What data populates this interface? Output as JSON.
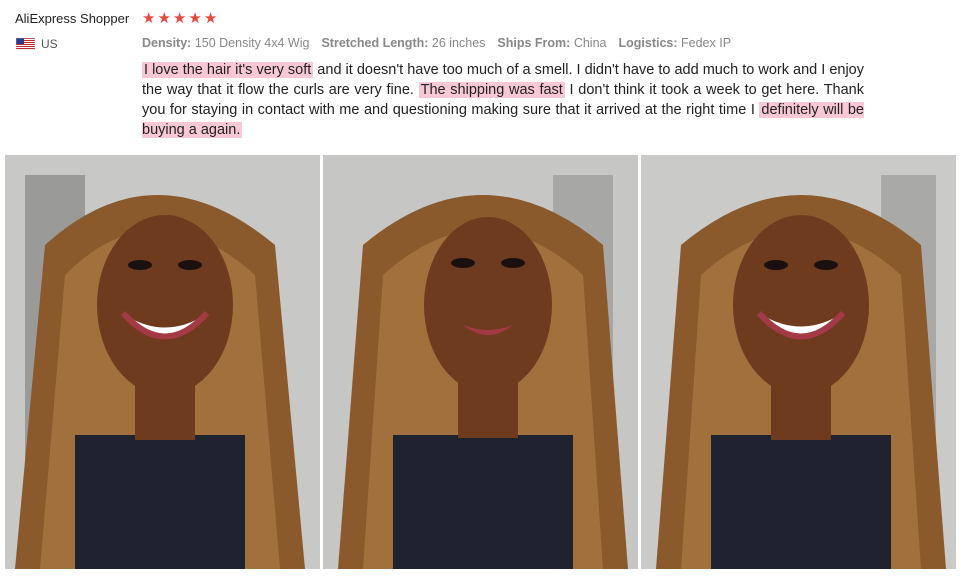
{
  "review": {
    "reviewer_name": "AliExpress Shopper",
    "rating": 5,
    "country": "US",
    "specs": [
      {
        "label": "Density:",
        "value": "150 Density 4x4 Wig"
      },
      {
        "label": "Stretched Length:",
        "value": "26 inches"
      },
      {
        "label": "Ships From:",
        "value": "China"
      },
      {
        "label": "Logistics:",
        "value": "Fedex IP"
      }
    ],
    "text": {
      "part1_highlight": "I love the hair it's very soft",
      "part2": " and it doesn't have too much of a smell. I didn't have to add much to work and I enjoy the way that it flow the curls are very fine. ",
      "part3_highlight": "The shipping was fast",
      "part4": " I don't think it took a week to get here. Thank you for staying in contact with me and questioning making sure that it arrived at the right time I ",
      "part5_highlight": "definitely will be buying a again."
    },
    "colors": {
      "star": "#e8473d",
      "highlight": "#f8c8d7"
    }
  }
}
